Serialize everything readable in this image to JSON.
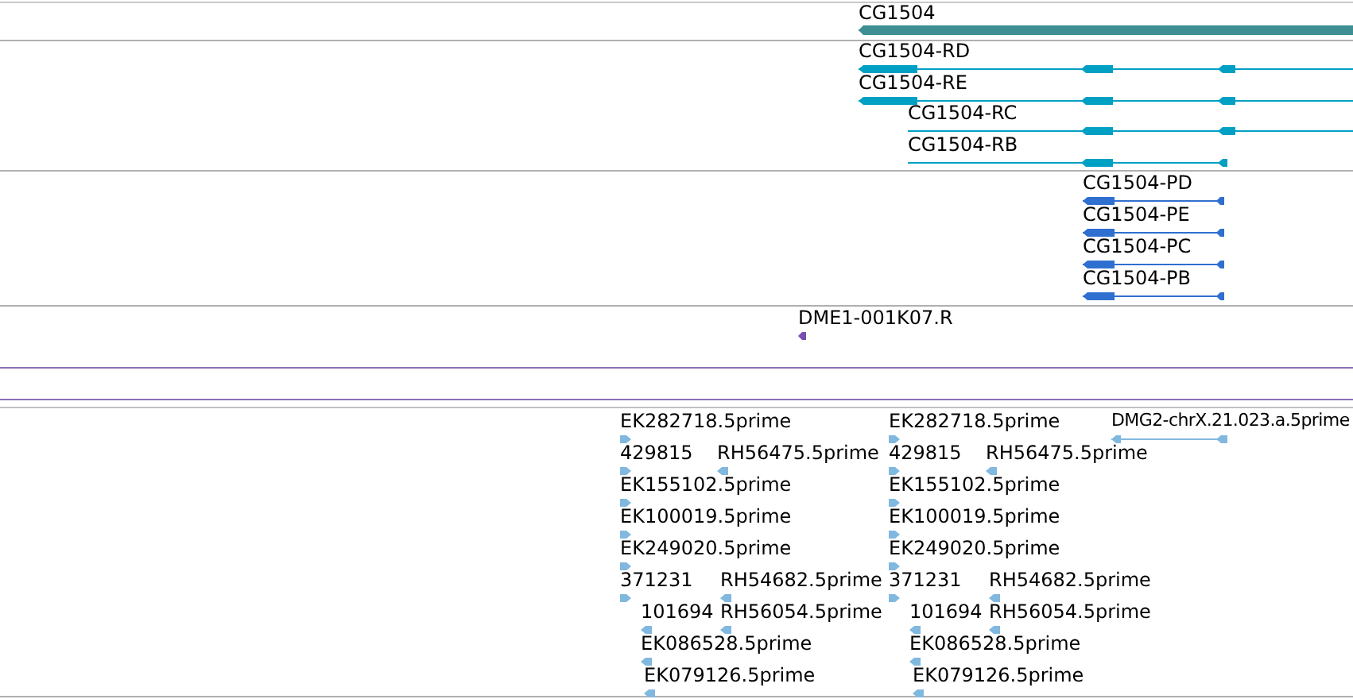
{
  "tracks": [
    {
      "kind": "gene",
      "features": [
        {
          "label": "CG1504",
          "reverse_strand": true
        }
      ]
    },
    {
      "kind": "transcript",
      "features": [
        {
          "label": "CG1504-RD",
          "reverse_strand": true
        },
        {
          "label": "CG1504-RE",
          "reverse_strand": true
        },
        {
          "label": "CG1504-RC",
          "reverse_strand": true
        },
        {
          "label": "CG1504-RB",
          "reverse_strand": true
        }
      ]
    },
    {
      "kind": "protein",
      "features": [
        {
          "label": "CG1504-PD",
          "reverse_strand": true
        },
        {
          "label": "CG1504-PE",
          "reverse_strand": true
        },
        {
          "label": "CG1504-PC",
          "reverse_strand": true
        },
        {
          "label": "CG1504-PB",
          "reverse_strand": true
        }
      ]
    },
    {
      "kind": "clone",
      "features": [
        {
          "label": "DME1-001K07.R",
          "reverse_strand": true
        }
      ]
    },
    {
      "kind": "est",
      "features": [
        {
          "label": "EK282718.5prime",
          "reverse_strand": false
        },
        {
          "label": "EK282718.5prime",
          "reverse_strand": false
        },
        {
          "label": "DMG2-chrX.21.023.a.5prime",
          "reverse_strand": true
        },
        {
          "label": "429815",
          "reverse_strand": false
        },
        {
          "label": "RH56475.5prime",
          "reverse_strand": true
        },
        {
          "label": "429815",
          "reverse_strand": false
        },
        {
          "label": "RH56475.5prime",
          "reverse_strand": true
        },
        {
          "label": "EK155102.5prime",
          "reverse_strand": false
        },
        {
          "label": "EK155102.5prime",
          "reverse_strand": false
        },
        {
          "label": "EK100019.5prime",
          "reverse_strand": false
        },
        {
          "label": "EK100019.5prime",
          "reverse_strand": false
        },
        {
          "label": "EK249020.5prime",
          "reverse_strand": false
        },
        {
          "label": "EK249020.5prime",
          "reverse_strand": false
        },
        {
          "label": "371231",
          "reverse_strand": false
        },
        {
          "label": "RH54682.5prime",
          "reverse_strand": true
        },
        {
          "label": "371231",
          "reverse_strand": false
        },
        {
          "label": "RH54682.5prime",
          "reverse_strand": true
        },
        {
          "label": "101694",
          "reverse_strand": true
        },
        {
          "label": "RH56054.5prime",
          "reverse_strand": true
        },
        {
          "label": "101694",
          "reverse_strand": true
        },
        {
          "label": "RH56054.5prime",
          "reverse_strand": true
        },
        {
          "label": "EK086528.5prime",
          "reverse_strand": true
        },
        {
          "label": "EK086528.5prime",
          "reverse_strand": true
        },
        {
          "label": "EK079126.5prime",
          "reverse_strand": true
        },
        {
          "label": "EK079126.5prime",
          "reverse_strand": true
        }
      ]
    }
  ]
}
